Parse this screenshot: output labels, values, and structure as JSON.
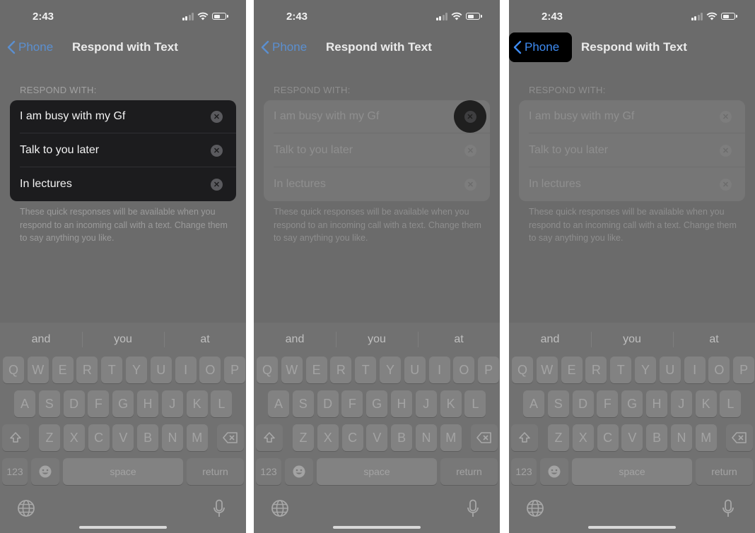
{
  "panels": [
    {
      "status_time": "2:43",
      "back_label": "Phone",
      "title": "Respond with Text",
      "section_header": "RESPOND WITH:",
      "responses": [
        "I am busy with my Gf",
        "Talk to you later",
        "In lectures"
      ],
      "footer": "These quick responses will be available when you respond to an incoming call with a text. Change them to say anything you like.",
      "highlight": "responses-group"
    },
    {
      "status_time": "2:43",
      "back_label": "Phone",
      "title": "Respond with Text",
      "section_header": "RESPOND WITH:",
      "responses": [
        "I am busy with my Gf",
        "Talk to you later",
        "In lectures"
      ],
      "footer": "These quick responses will be available when you respond to an incoming call with a text. Change them to say anything you like.",
      "highlight": "first-clear-button"
    },
    {
      "status_time": "2:43",
      "back_label": "Phone",
      "title": "Respond with Text",
      "section_header": "RESPOND WITH:",
      "responses": [
        "I am busy with my Gf",
        "Talk to you later",
        "In lectures"
      ],
      "footer": "These quick responses will be available when you respond to an incoming call with a text. Change them to say anything you like.",
      "highlight": "back-button"
    }
  ],
  "keyboard": {
    "suggestions": [
      "and",
      "you",
      "at"
    ],
    "row1": [
      "Q",
      "W",
      "E",
      "R",
      "T",
      "Y",
      "U",
      "I",
      "O",
      "P"
    ],
    "row2": [
      "A",
      "S",
      "D",
      "F",
      "G",
      "H",
      "J",
      "K",
      "L"
    ],
    "row3": [
      "Z",
      "X",
      "C",
      "V",
      "B",
      "N",
      "M"
    ],
    "numbers_key": "123",
    "space_key": "space",
    "return_key": "return"
  },
  "icons": {
    "back": "chevron-left-icon",
    "clear": "clear-circle-x-icon",
    "shift": "shift-arrow-icon",
    "delete": "backspace-icon",
    "emoji": "emoji-face-icon",
    "globe": "globe-icon",
    "mic": "microphone-icon"
  },
  "colors": {
    "highlight_bg": "#000000",
    "link_blue": "#3e8bf2",
    "dim_overlay_bg": "#6b6b6b"
  }
}
